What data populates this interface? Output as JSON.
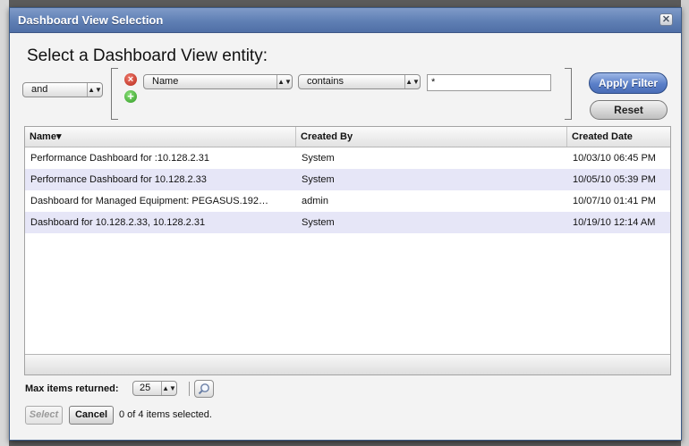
{
  "dialog": {
    "title": "Dashboard View Selection",
    "close_glyph": "✕",
    "heading": "Select a Dashboard View entity:"
  },
  "filter": {
    "logic_value": "and",
    "field_value": "Name",
    "operator_value": "contains",
    "text_value": "*",
    "apply_label": "Apply Filter",
    "reset_label": "Reset"
  },
  "table": {
    "columns": [
      "Name▾",
      "Created By",
      "Created Date"
    ],
    "rows": [
      {
        "name": "Performance Dashboard for :10.128.2.31",
        "created_by": "System",
        "created_date": "10/03/10 06:45 PM"
      },
      {
        "name": "Performance Dashboard for 10.128.2.33",
        "created_by": "System",
        "created_date": "10/05/10 05:39 PM"
      },
      {
        "name": "Dashboard for Managed Equipment: PEGASUS.192…",
        "created_by": "admin",
        "created_date": "10/07/10 01:41 PM"
      },
      {
        "name": "Dashboard for 10.128.2.33, 10.128.2.31",
        "created_by": "System",
        "created_date": "10/19/10 12:14 AM"
      }
    ]
  },
  "footer": {
    "max_items_label": "Max items returned:",
    "max_items_value": "25",
    "select_label": "Select",
    "cancel_label": "Cancel",
    "status_text": "0 of 4 items selected."
  },
  "icons": {
    "remove": "remove-circle-icon",
    "add": "add-circle-icon",
    "search": "magnifier-icon"
  },
  "colors": {
    "titlebar": "#5f7fb4",
    "alt_row": "#e6e6f7",
    "apply_button": "#5a7fc8"
  }
}
